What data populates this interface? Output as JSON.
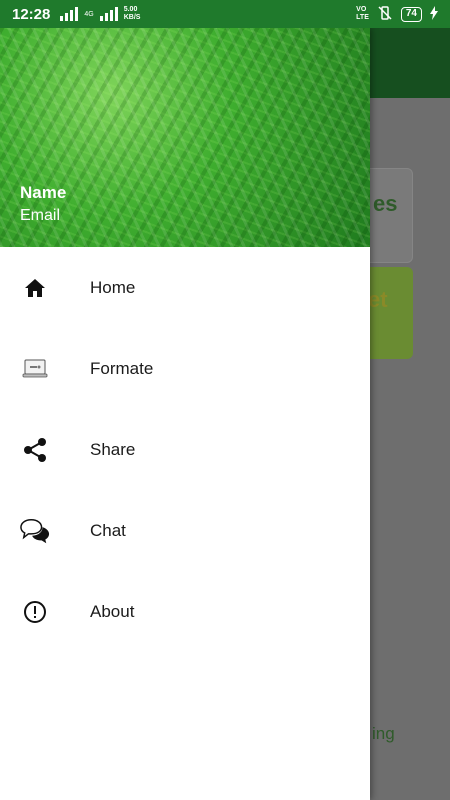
{
  "status_bar": {
    "time": "12:28",
    "network_small": "4G",
    "speed_value": "5.00",
    "speed_unit": "KB/S",
    "volte_top": "VO",
    "volte_bottom": "LTE",
    "battery": "74"
  },
  "background": {
    "card1_text": "es",
    "card2_text": "et",
    "bottom_text": "ing"
  },
  "drawer": {
    "header": {
      "name": "Name",
      "email": "Email"
    },
    "items": [
      {
        "label": "Home",
        "icon": "home-icon"
      },
      {
        "label": "Formate",
        "icon": "laptop-icon"
      },
      {
        "label": "Share",
        "icon": "share-icon"
      },
      {
        "label": "Chat",
        "icon": "chat-icon"
      },
      {
        "label": "About",
        "icon": "info-icon"
      }
    ]
  },
  "colors": {
    "status_bar": "#1f7a2c",
    "toolbar": "#164f1f",
    "drawer_bg": "#ffffff",
    "scrim": "#6e6e6e"
  }
}
